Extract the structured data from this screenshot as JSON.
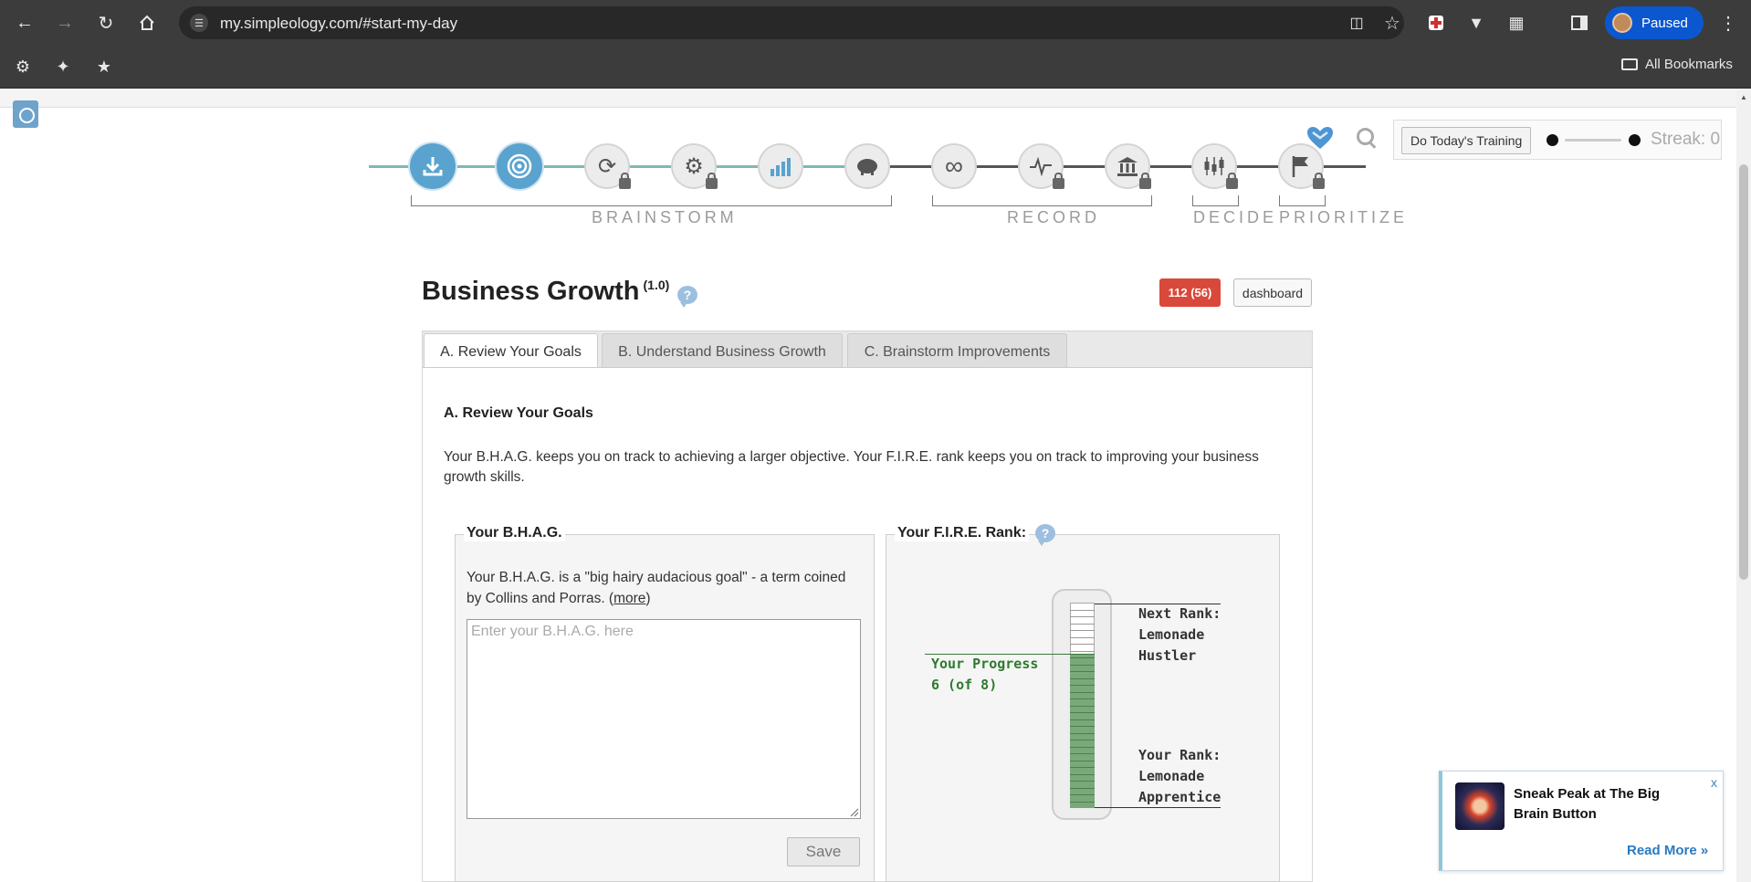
{
  "browser": {
    "url": "my.simpleology.com/#start-my-day",
    "profile_label": "Paused",
    "bookmarks_label": "All Bookmarks"
  },
  "progress_path": {
    "steps": [
      {
        "name": "download",
        "state": "active"
      },
      {
        "name": "target",
        "state": "active"
      },
      {
        "name": "cycle",
        "state": "locked"
      },
      {
        "name": "gears",
        "state": "locked"
      },
      {
        "name": "growth-chart",
        "state": "unlocked"
      },
      {
        "name": "piggy-bank",
        "state": "locked"
      },
      {
        "name": "infinity-loop",
        "state": "unlocked"
      },
      {
        "name": "pulse",
        "state": "locked"
      },
      {
        "name": "bank",
        "state": "locked"
      },
      {
        "name": "candlestick",
        "state": "locked"
      },
      {
        "name": "flag",
        "state": "locked"
      }
    ],
    "phases": [
      "BRAINSTORM",
      "RECORD",
      "DECIDE",
      "PRIORITIZE"
    ]
  },
  "toolbar": {
    "training_label": "Do Today's Training",
    "streak_label": "Streak: 0"
  },
  "header": {
    "title": "Business Growth",
    "version": "(1.0)",
    "help_glyph": "?",
    "badge_label": "112 (56)",
    "dashboard_label": "dashboard"
  },
  "tabs": [
    {
      "label": "A. Review Your Goals",
      "active": true
    },
    {
      "label": "B. Understand Business Growth",
      "active": false
    },
    {
      "label": "C. Brainstorm Improvements",
      "active": false
    }
  ],
  "section": {
    "title": "A. Review Your Goals",
    "intro": "Your B.H.A.G. keeps you on track to achieving a larger objective.  Your F.I.R.E. rank keeps you on track to improving your business growth skills."
  },
  "bhag": {
    "legend": "Your B.H.A.G.",
    "description_prefix": "Your B.H.A.G. is a \"big hairy audacious goal\" - a term coined by Collins and Porras. (",
    "more_label": "more",
    "description_suffix": ")",
    "placeholder": "Enter your B.H.A.G. here",
    "value": "",
    "save_label": "Save"
  },
  "fire": {
    "legend": "Your F.I.R.E. Rank:",
    "help_glyph": "?",
    "next_rank_label": "Next Rank:",
    "next_rank_name_1": "Lemonade",
    "next_rank_name_2": "Hustler",
    "progress_label": "Your Progress",
    "progress_value": "6 (of 8)",
    "progress_fraction": 0.75,
    "your_rank_label": "Your Rank:",
    "your_rank_name_1": "Lemonade",
    "your_rank_name_2": "Apprentice"
  },
  "notification": {
    "title": "Sneak Peak at The Big Brain Button",
    "close_label": "x",
    "read_more_label": "Read More »"
  },
  "colors": {
    "accent": "#5aa3cf",
    "badge_red": "#d9493b",
    "progress_green": "#79a979",
    "link_blue": "#2a7ac0"
  }
}
